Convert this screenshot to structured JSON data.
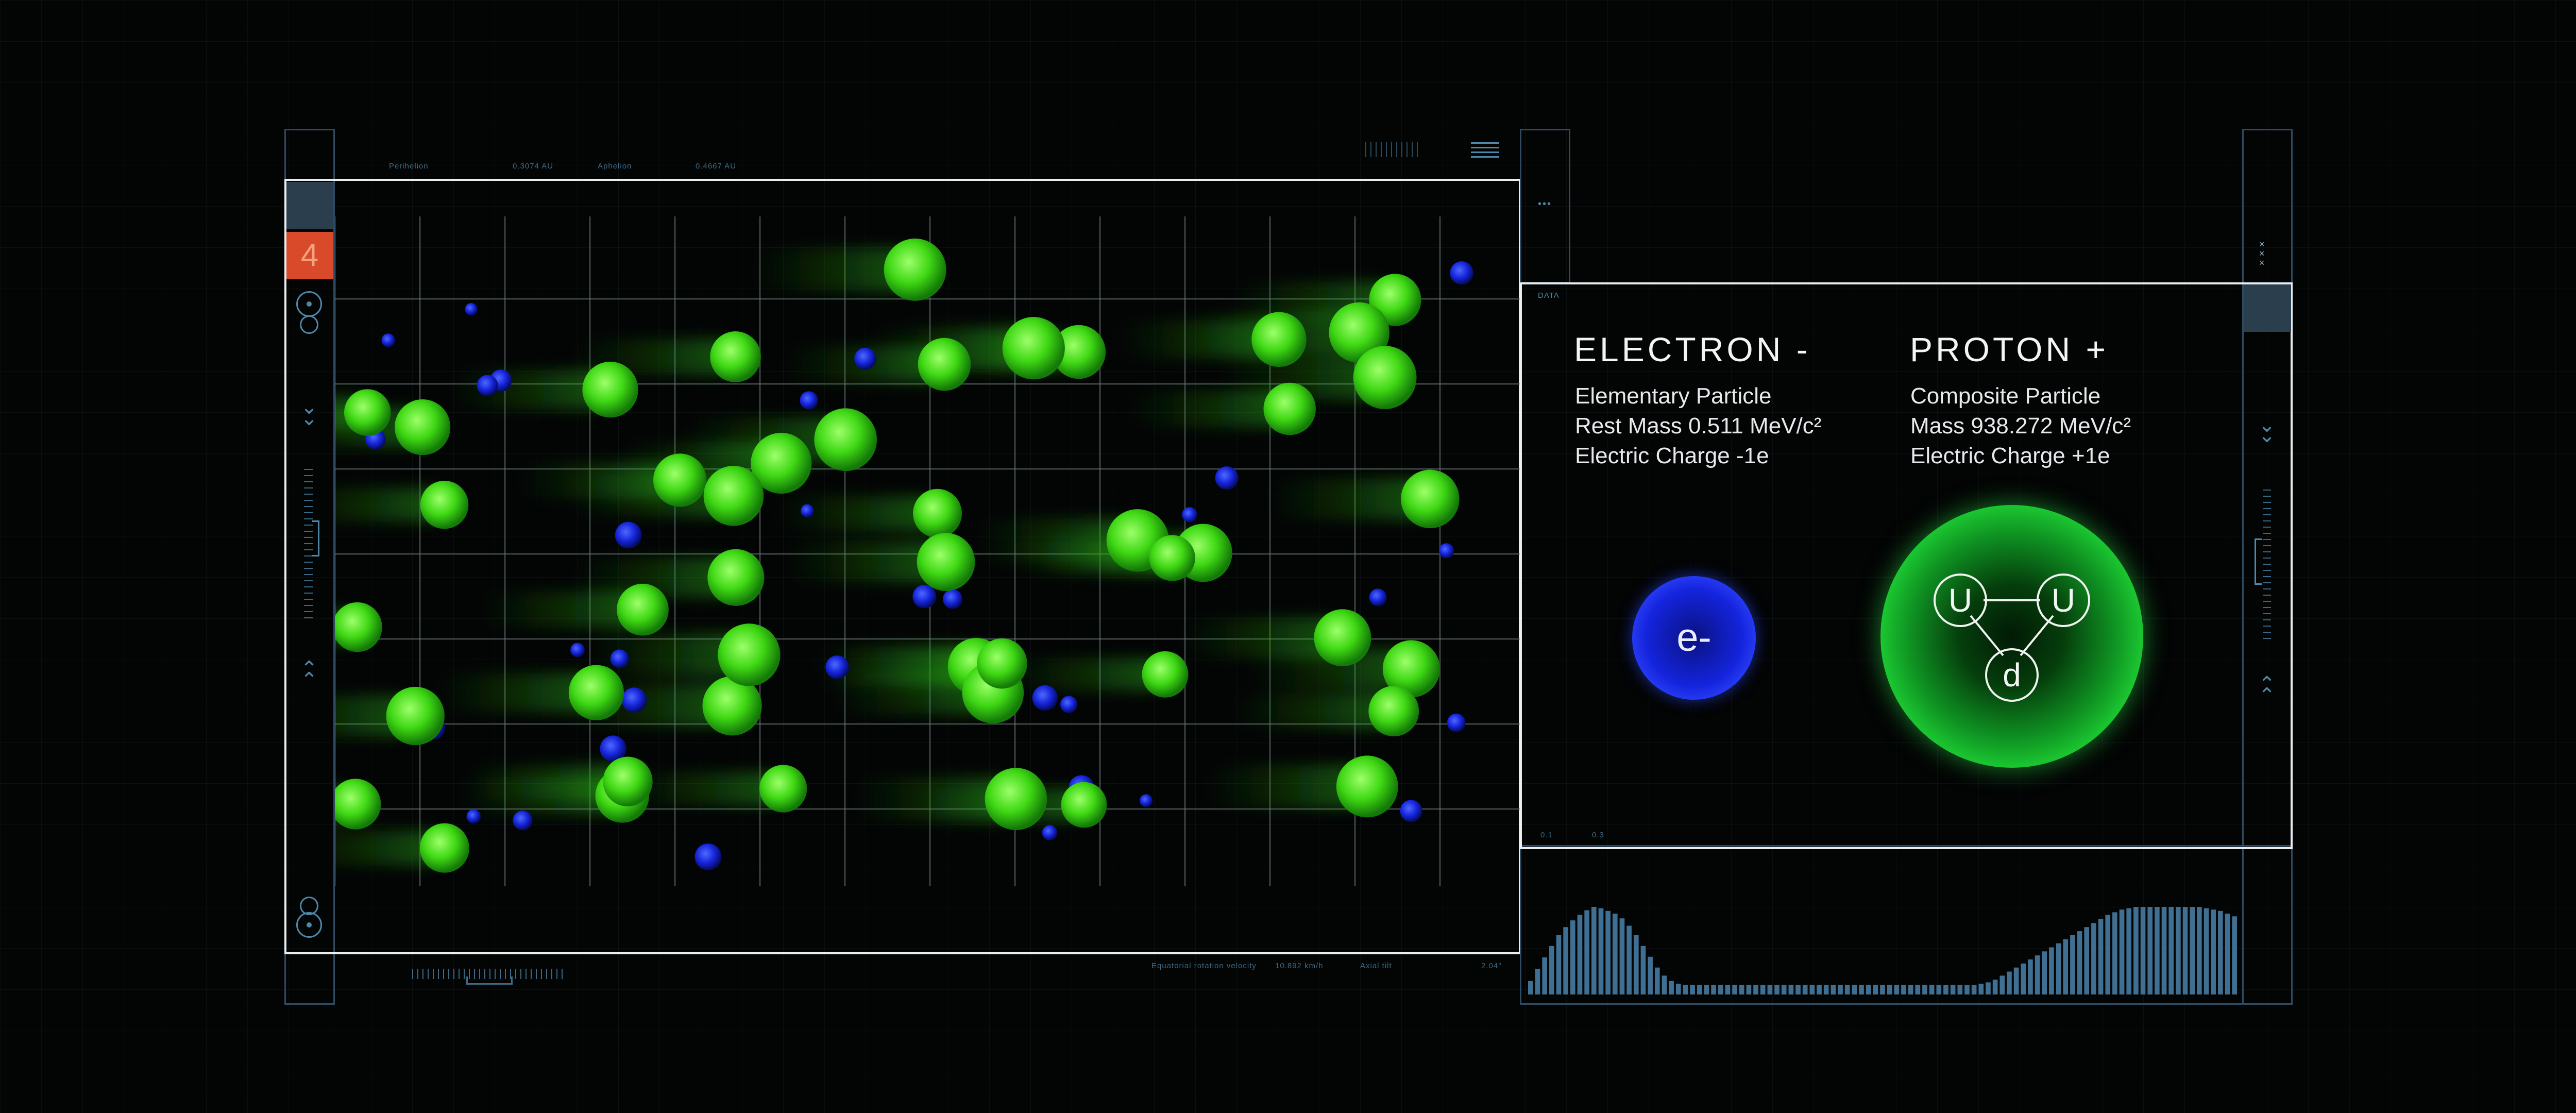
{
  "top_meta": {
    "label_a": "Perihelion",
    "value_a": "0.3074 AU",
    "label_b": "Aphelion",
    "value_b": "0.4667 AU"
  },
  "rail": {
    "badge_number": "4"
  },
  "bottom_meta": {
    "label": "Equatorial rotation velocity",
    "value": "10.892 km/h",
    "label2": "Axial tilt",
    "value2": "2.04°"
  },
  "data_panel": {
    "tag": "DATA",
    "corner_tag": "•••",
    "bottom_tag_a": "0.1",
    "bottom_tag_b": "0.3"
  },
  "electron": {
    "name": "ELECTRON -",
    "line1": "Elementary Particle",
    "line2": "Rest Mass 0.511 MeV/c²",
    "line3": "Electric Charge -1e",
    "symbol": "e-",
    "color": "#1b2ef0"
  },
  "proton": {
    "name": "PROTON +",
    "line1": "Composite Particle",
    "line2": "Mass 938.272 MeV/c²",
    "line3": "Electric Charge +1e",
    "quark_1": "U",
    "quark_2": "U",
    "quark_3": "d",
    "color": "#22e63a"
  },
  "histogram": {
    "color": "#3f6f92",
    "values": [
      20,
      38,
      55,
      72,
      88,
      100,
      110,
      118,
      125,
      130,
      128,
      124,
      120,
      113,
      102,
      88,
      72,
      56,
      40,
      28,
      20,
      16,
      14,
      14,
      14,
      14,
      14,
      14,
      14,
      14,
      14,
      14,
      14,
      14,
      14,
      14,
      14,
      14,
      14,
      14,
      14,
      14,
      14,
      14,
      14,
      14,
      14,
      14,
      14,
      14,
      14,
      14,
      14,
      14,
      14,
      14,
      14,
      14,
      14,
      14,
      14,
      14,
      14,
      14,
      16,
      18,
      22,
      28,
      34,
      40,
      46,
      52,
      58,
      64,
      70,
      76,
      82,
      88,
      94,
      100,
      106,
      112,
      118,
      122,
      126,
      128,
      130,
      130,
      130,
      130,
      130,
      130,
      130,
      130,
      130,
      130,
      128,
      126,
      124,
      120,
      116
    ]
  }
}
